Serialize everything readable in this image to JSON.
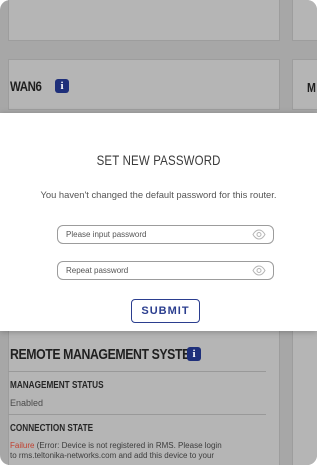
{
  "background": {
    "wan_section": {
      "title": "WAN6",
      "right_partial_letter": "M"
    },
    "rms_section": {
      "title": "REMOTE MANAGEMENT SYSTEM",
      "management_status": {
        "label": "MANAGEMENT STATUS",
        "value": "Enabled"
      },
      "connection_state": {
        "label": "CONNECTION STATE",
        "status_word": "Failure",
        "status_detail_line1": " (Error: Device is not registered in RMS. Please login",
        "status_detail_line2": "to rms.teltonika-networks.com and add this device to your"
      }
    }
  },
  "modal": {
    "title": "SET NEW PASSWORD",
    "message": "You haven't changed the default password for this router.",
    "password_field": {
      "placeholder": "Please input password",
      "value": ""
    },
    "repeat_field": {
      "placeholder": "Repeat password",
      "value": ""
    },
    "submit_label": "SUBMIT"
  },
  "colors": {
    "accent": "#2b3e8f",
    "info_icon": "#1e2f7a",
    "failure": "#c0402f",
    "overlay": "#a7a7a7"
  },
  "icons": {
    "info": "info-icon",
    "password_toggle": "eye-icon"
  }
}
